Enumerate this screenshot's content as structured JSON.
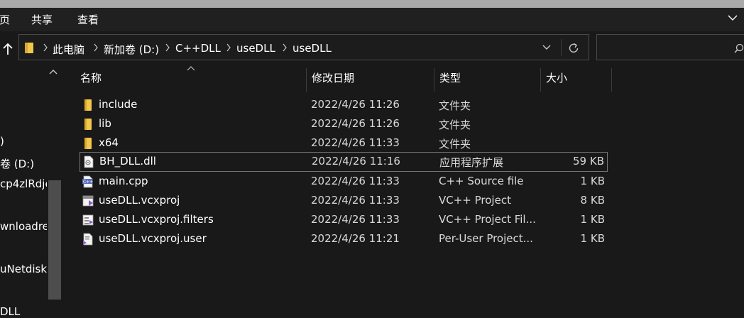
{
  "ribbon": {
    "tabs": [
      {
        "label": "页"
      },
      {
        "label": "共享"
      },
      {
        "label": "查看"
      }
    ]
  },
  "address": {
    "crumbs": [
      "此电脑",
      "新加卷 (D:)",
      "C++DLL",
      "useDLL",
      "useDLL"
    ]
  },
  "search": {
    "placeholder": ""
  },
  "nav_pane": {
    "items": [
      ")",
      "卷 (D:)",
      "cp4zlRdje",
      "wnloadre",
      "uNetdiskl",
      "DLL"
    ]
  },
  "columns": [
    "名称",
    "修改日期",
    "类型",
    "大小"
  ],
  "files": [
    {
      "name": "include",
      "date": "2022/4/26 11:26",
      "type": "文件夹",
      "size": "",
      "icon": "folder-icon"
    },
    {
      "name": "lib",
      "date": "2022/4/26 11:26",
      "type": "文件夹",
      "size": "",
      "icon": "folder-icon"
    },
    {
      "name": "x64",
      "date": "2022/4/26 11:33",
      "type": "文件夹",
      "size": "",
      "icon": "folder-icon"
    },
    {
      "name": "BH_DLL.dll",
      "date": "2022/4/26 11:16",
      "type": "应用程序扩展",
      "size": "59 KB",
      "icon": "dll-file-icon",
      "selected": true
    },
    {
      "name": "main.cpp",
      "date": "2022/4/26 11:33",
      "type": "C++ Source file",
      "size": "1 KB",
      "icon": "cpp-file-icon"
    },
    {
      "name": "useDLL.vcxproj",
      "date": "2022/4/26 11:33",
      "type": "VC++ Project",
      "size": "8 KB",
      "icon": "vcxproj-file-icon"
    },
    {
      "name": "useDLL.vcxproj.filters",
      "date": "2022/4/26 11:33",
      "type": "VC++ Project Fil...",
      "size": "1 KB",
      "icon": "filters-file-icon"
    },
    {
      "name": "useDLL.vcxproj.user",
      "date": "2022/4/26 11:21",
      "type": "Per-User Project...",
      "size": "1 KB",
      "icon": "user-file-icon"
    }
  ],
  "colors": {
    "background": "#191919",
    "folder": "#f2c84b",
    "selection_border": "#777777"
  }
}
